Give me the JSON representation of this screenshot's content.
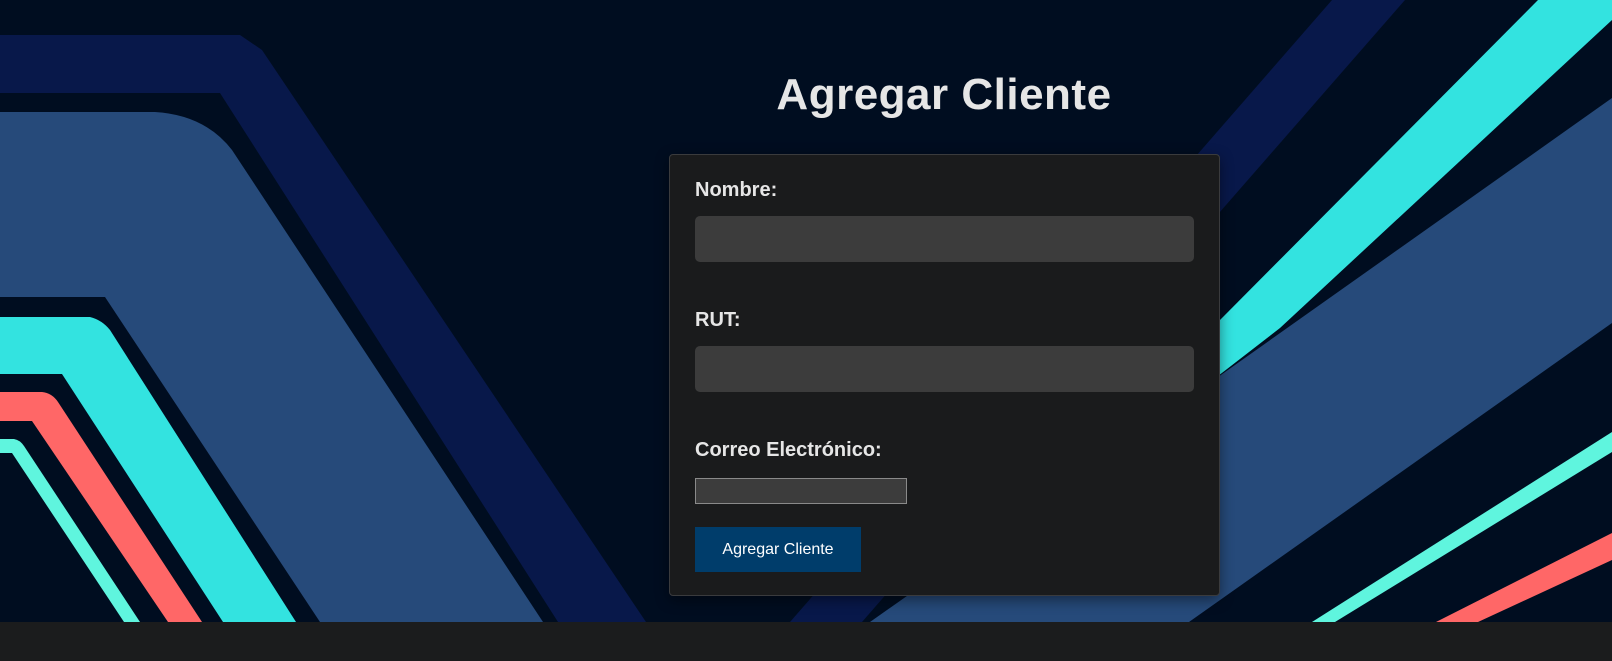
{
  "page": {
    "title": "Agregar Cliente"
  },
  "form": {
    "nombre_label": "Nombre:",
    "nombre_value": "",
    "rut_label": "RUT:",
    "rut_value": "",
    "correo_label": "Correo Electrónico:",
    "correo_value": "",
    "submit_label": "Agregar Cliente"
  },
  "colors": {
    "background": "#000d20",
    "navy_stripe": "#08184a",
    "slate_blue": "#264a7a",
    "cyan": "#33e3e0",
    "aqua": "#5ff5de",
    "coral": "#ff6767",
    "card": "#1a1b1c",
    "input": "#3c3c3c",
    "button": "#003d6b",
    "footer": "#1b1c1d"
  }
}
